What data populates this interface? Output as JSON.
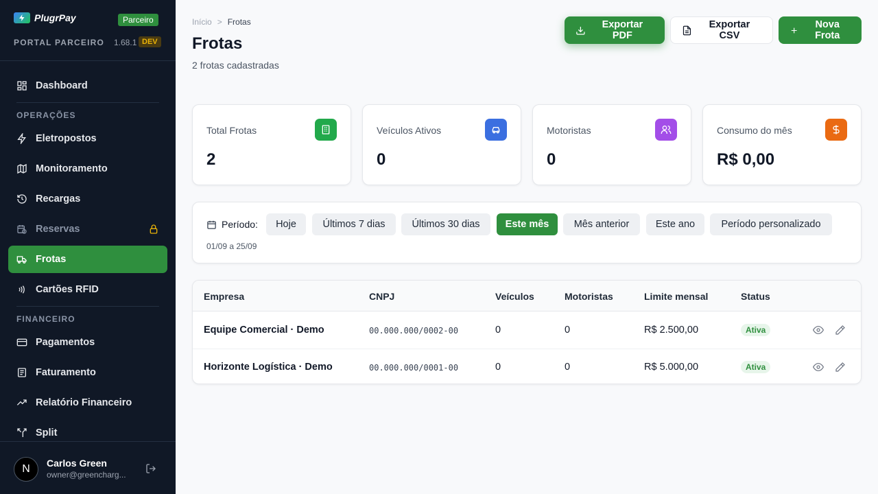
{
  "brand": {
    "name": "PlugrPay",
    "partner_badge": "Parceiro",
    "portal_label": "PORTAL PARCEIRO",
    "version": "1.68.1",
    "env_badge": "DEV"
  },
  "sidebar": {
    "items": [
      {
        "label": "Dashboard",
        "icon": "grid-icon"
      },
      {
        "label": "Eletropostos",
        "icon": "bolt-icon"
      },
      {
        "label": "Monitoramento",
        "icon": "map-icon"
      },
      {
        "label": "Recargas",
        "icon": "history-icon"
      },
      {
        "label": "Reservas",
        "icon": "calendar-clock-icon",
        "locked": true
      },
      {
        "label": "Frotas",
        "icon": "truck-icon",
        "active": true
      },
      {
        "label": "Cartões RFID",
        "icon": "nfc-icon"
      },
      {
        "label": "Pagamentos",
        "icon": "card-icon"
      },
      {
        "label": "Faturamento",
        "icon": "receipt-icon"
      },
      {
        "label": "Relatório Financeiro",
        "icon": "trending-icon"
      },
      {
        "label": "Split",
        "icon": "split-icon"
      }
    ],
    "sections": {
      "operations": "OPERAÇÕES",
      "finance": "FINANCEIRO"
    }
  },
  "user": {
    "initial": "N",
    "name": "Carlos Green",
    "email": "owner@greencharg..."
  },
  "breadcrumb": {
    "home": "Início",
    "separator": ">",
    "current": "Frotas"
  },
  "page": {
    "title": "Frotas",
    "subtitle": "2 frotas cadastradas"
  },
  "actions": {
    "export_pdf": "Exportar PDF",
    "export_csv": "Exportar CSV",
    "new_fleet": "Nova Frota"
  },
  "stats": [
    {
      "label": "Total Frotas",
      "value": "2",
      "color": "#22a94b",
      "icon": "building-icon"
    },
    {
      "label": "Veículos Ativos",
      "value": "0",
      "color": "#3b6fe0",
      "icon": "car-icon"
    },
    {
      "label": "Motoristas",
      "value": "0",
      "color": "#a34ee8",
      "icon": "users-icon"
    },
    {
      "label": "Consumo do mês",
      "value": "R$ 0,00",
      "color": "#ea6a12",
      "icon": "dollar-icon"
    }
  ],
  "period": {
    "label": "Período:",
    "options": [
      "Hoje",
      "Últimos 7 dias",
      "Últimos 30 dias",
      "Este mês",
      "Mês anterior",
      "Este ano",
      "Período personalizado"
    ],
    "selected": "Este mês",
    "range": "01/09 a 25/09"
  },
  "table": {
    "columns": [
      "Empresa",
      "CNPJ",
      "Veículos",
      "Motoristas",
      "Limite mensal",
      "Status"
    ],
    "rows": [
      {
        "company": "Equipe Comercial · Demo",
        "cnpj": "00.000.000/0002-00",
        "vehicles": "0",
        "drivers": "0",
        "limit": "R$ 2.500,00",
        "status": "Ativa"
      },
      {
        "company": "Horizonte Logística · Demo",
        "cnpj": "00.000.000/0001-00",
        "vehicles": "0",
        "drivers": "0",
        "limit": "R$ 5.000,00",
        "status": "Ativa"
      }
    ]
  },
  "colors": {
    "accent": "#2f8f3e",
    "sidebar_bg": "#101826"
  }
}
